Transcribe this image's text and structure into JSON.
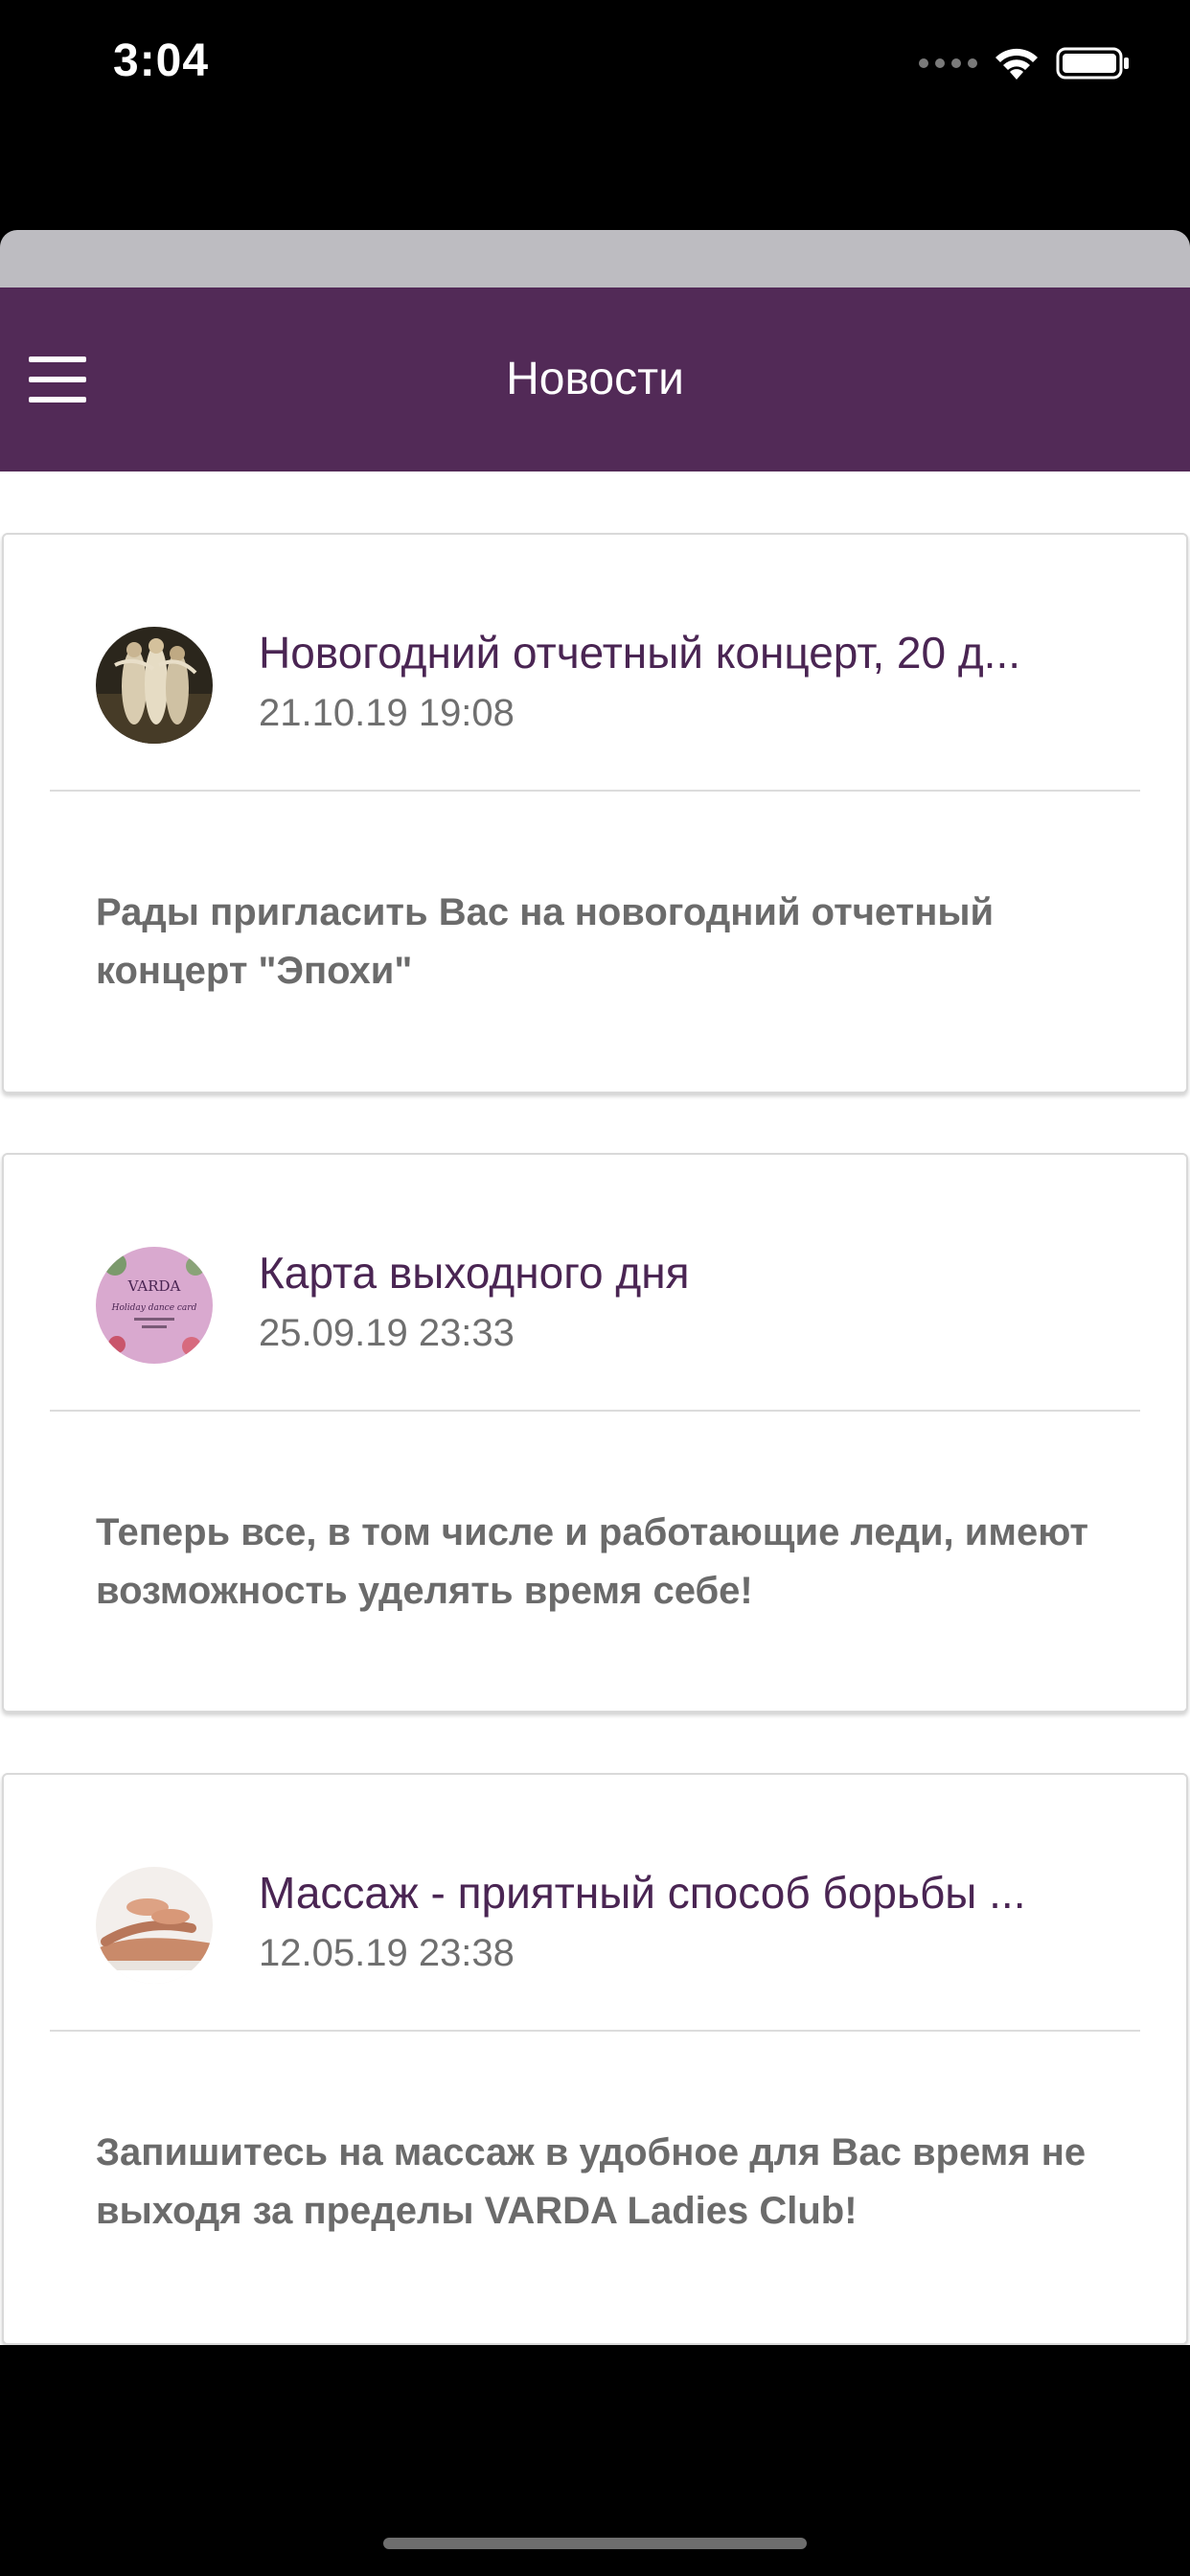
{
  "status_bar": {
    "time": "3:04"
  },
  "nav": {
    "title": "Новости",
    "background": "#522a57"
  },
  "news": [
    {
      "title": "Новогодний отчетный концерт, 20 д...",
      "date": "21.10.19 19:08",
      "text": "Рады пригласить Вас на новогодний отчетный концерт \"Эпохи\"",
      "avatar": "dance-painting-thumbnail"
    },
    {
      "title": "Карта выходного дня",
      "date": "25.09.19 23:33",
      "text": "Теперь все, в том числе и работающие леди, имеют возможность уделять время себе!",
      "avatar": "varda-holiday-card-thumbnail",
      "avatar_text": {
        "brand": "VARDA",
        "line": "Holiday dance card"
      }
    },
    {
      "title": "Массаж - приятный способ борьбы ...",
      "date": "12.05.19 23:38",
      "text": "Запишитесь на массаж в удобное для Вас время не выходя за пределы VARDA Ladies Club!",
      "avatar": "massage-thumbnail"
    }
  ]
}
